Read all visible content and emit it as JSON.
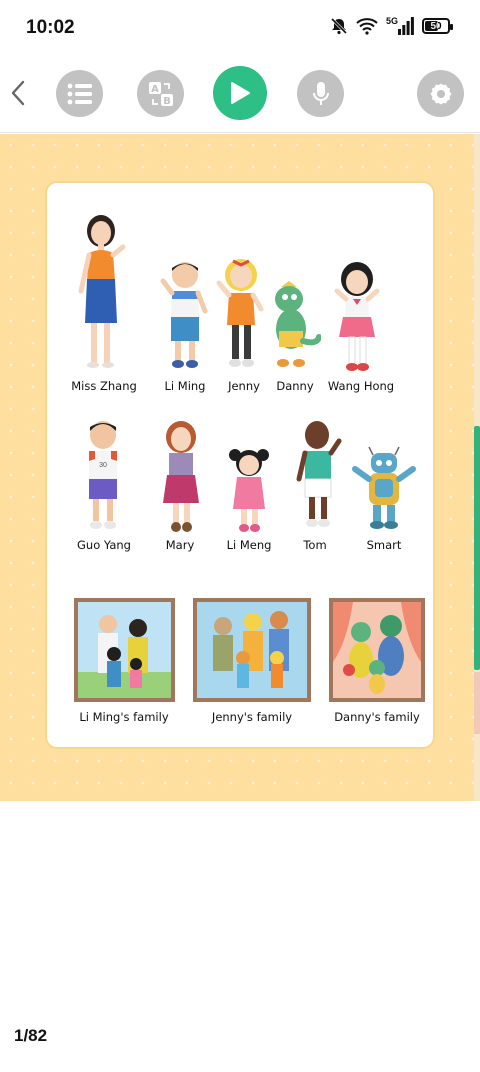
{
  "status": {
    "time": "10:02",
    "network": "5G",
    "battery": "50"
  },
  "toolbar": {
    "back_label": "<",
    "buttons": [
      "menu",
      "translate",
      "play",
      "microphone",
      "settings"
    ]
  },
  "book": {
    "characters_row1": [
      "Miss Zhang",
      "Li Ming",
      "Jenny",
      "Danny",
      "Wang Hong"
    ],
    "characters_row2": [
      "Guo Yang",
      "Mary",
      "Li Meng",
      "Tom",
      "Smart"
    ],
    "families": [
      "Li Ming's family",
      "Jenny's family",
      "Danny's family"
    ],
    "page_indicator": "1/82"
  },
  "colors": {
    "accent": "#2dbf85",
    "page_bg": "#fedfa0",
    "button_grey": "#c2c2c2"
  }
}
